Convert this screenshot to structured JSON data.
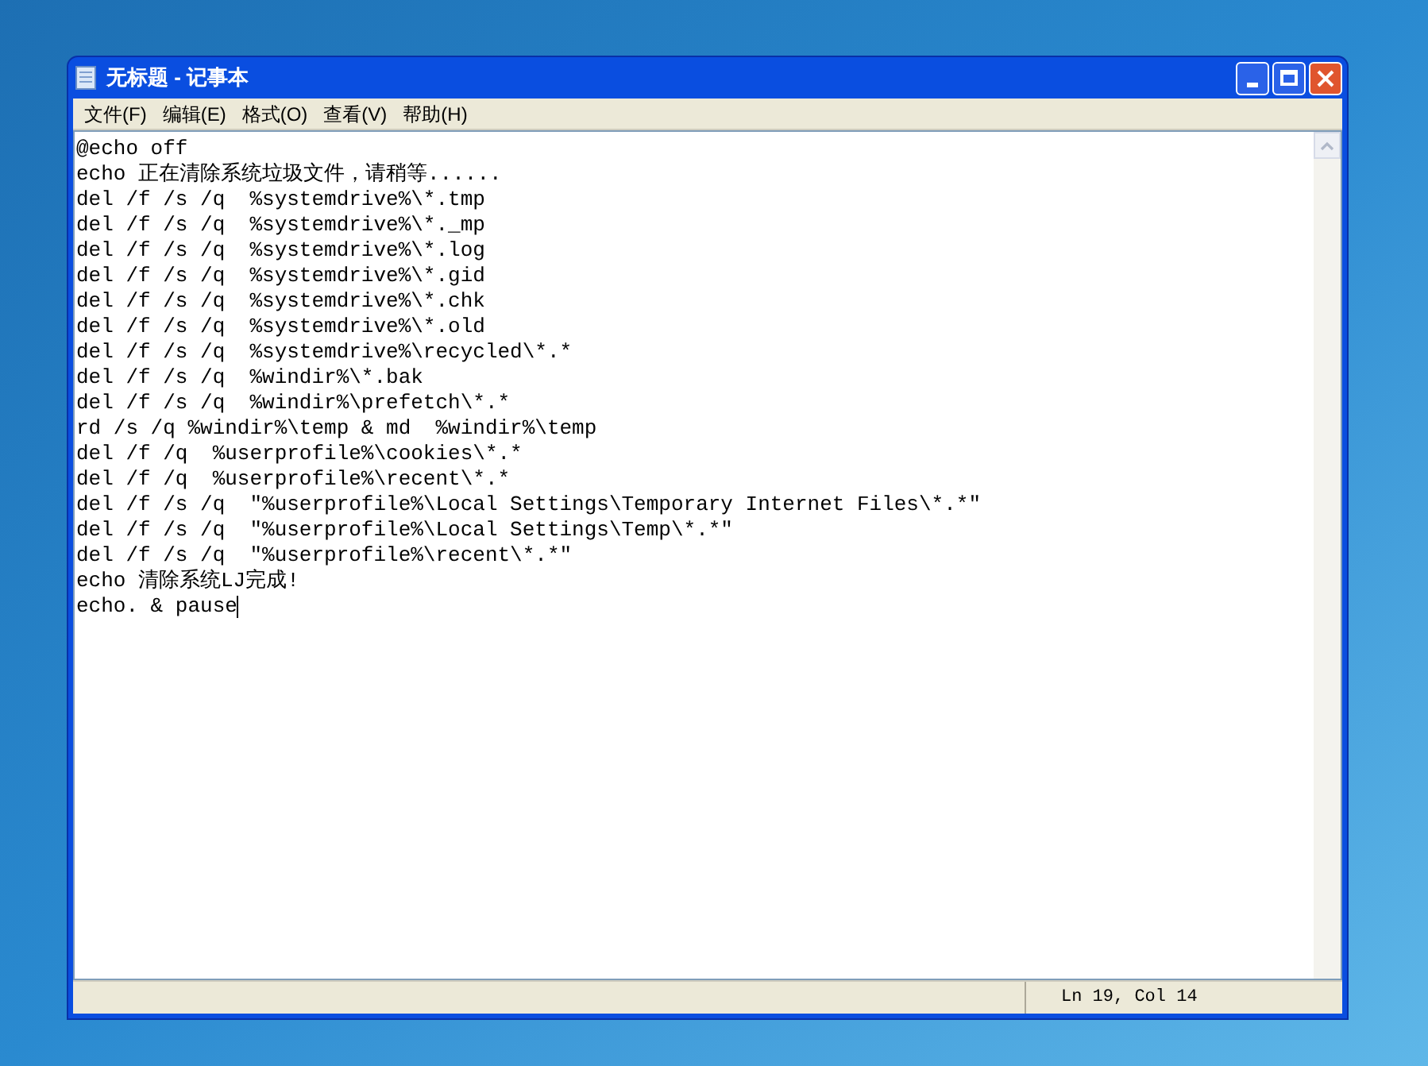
{
  "window": {
    "title": "无标题 - 记事本"
  },
  "menu": [
    {
      "label": "文件(F)"
    },
    {
      "label": "编辑(E)"
    },
    {
      "label": "格式(O)"
    },
    {
      "label": "查看(V)"
    },
    {
      "label": "帮助(H)"
    }
  ],
  "editor": {
    "lines": [
      "@echo off",
      "echo 正在清除系统垃圾文件，请稍等......",
      "del /f /s /q  %systemdrive%\\*.tmp",
      "del /f /s /q  %systemdrive%\\*._mp",
      "del /f /s /q  %systemdrive%\\*.log",
      "del /f /s /q  %systemdrive%\\*.gid",
      "del /f /s /q  %systemdrive%\\*.chk",
      "del /f /s /q  %systemdrive%\\*.old",
      "del /f /s /q  %systemdrive%\\recycled\\*.*",
      "del /f /s /q  %windir%\\*.bak",
      "del /f /s /q  %windir%\\prefetch\\*.*",
      "rd /s /q %windir%\\temp & md  %windir%\\temp",
      "del /f /q  %userprofile%\\cookies\\*.*",
      "del /f /q  %userprofile%\\recent\\*.*",
      "del /f /s /q  \"%userprofile%\\Local Settings\\Temporary Internet Files\\*.*\"",
      "del /f /s /q  \"%userprofile%\\Local Settings\\Temp\\*.*\"",
      "del /f /s /q  \"%userprofile%\\recent\\*.*\"",
      "echo 清除系统LJ完成!",
      "echo. & pause"
    ]
  },
  "status_bar": {
    "position": "Ln 19, Col 14"
  }
}
